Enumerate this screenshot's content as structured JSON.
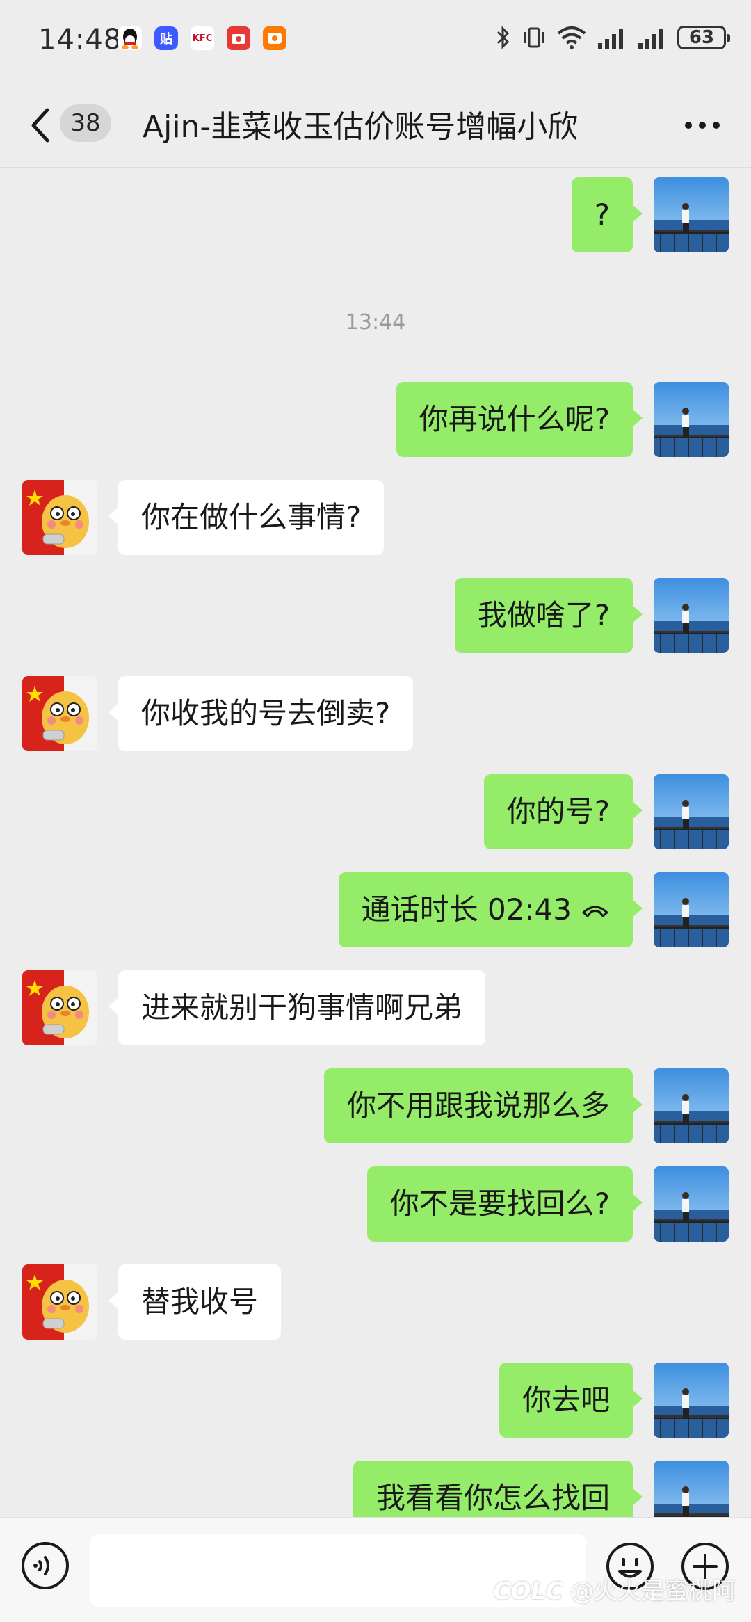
{
  "status_bar": {
    "time": "14:48",
    "battery": "63",
    "left_icons": [
      "qq-icon",
      "tieba-icon",
      "kfc-icon",
      "food-delivery-icon",
      "orange-app-icon"
    ],
    "right_icons": [
      "bluetooth-icon",
      "vibrate-icon",
      "wifi-icon",
      "signal-icon",
      "signal-icon"
    ]
  },
  "header": {
    "unread_count": "38",
    "title": "Ajin-韭菜收玉估价账号增幅小欣"
  },
  "messages": [
    {
      "side": "out",
      "text": "?"
    },
    {
      "side": "time",
      "text": "13:44"
    },
    {
      "side": "out",
      "text": "你再说什么呢?"
    },
    {
      "side": "in",
      "text": "你在做什么事情?"
    },
    {
      "side": "out",
      "text": "我做啥了?"
    },
    {
      "side": "in",
      "text": "你收我的号去倒卖?"
    },
    {
      "side": "out",
      "text": "你的号?"
    },
    {
      "side": "out",
      "text": "通话时长 02:43"
    },
    {
      "side": "in",
      "text": "进来就别干狗事情啊兄弟"
    },
    {
      "side": "out",
      "text": "你不用跟我说那么多"
    },
    {
      "side": "out",
      "text": "你不是要找回么?"
    },
    {
      "side": "in",
      "text": "替我收号"
    },
    {
      "side": "out",
      "text": "你去吧"
    },
    {
      "side": "out",
      "text": "我看看你怎么找回"
    }
  ],
  "watermark": "@火火是蜜桃阿",
  "colors": {
    "outgoing": "#95ec69",
    "incoming": "#ffffff",
    "background": "#ededed"
  }
}
